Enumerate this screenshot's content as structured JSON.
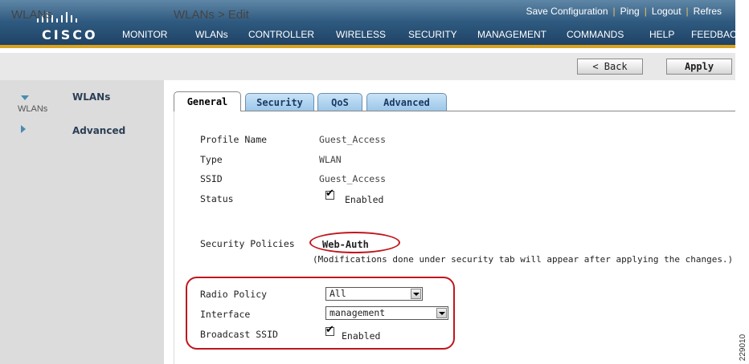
{
  "brand": {
    "logo_text": "CISCO"
  },
  "utility_links": {
    "save_configuration": "Save Configuration",
    "ping": "Ping",
    "logout": "Logout",
    "refresh": "Refres"
  },
  "main_nav": {
    "monitor": "MONITOR",
    "wlans": "WLANs",
    "controller": "CONTROLLER",
    "wireless": "WIRELESS",
    "security": "SECURITY",
    "management": "MANAGEMENT",
    "commands": "COMMANDS",
    "help": "HELP",
    "feedback": "FEEDBAC"
  },
  "sidebar": {
    "title": "WLANs",
    "items": [
      {
        "label": "WLANs",
        "sublabel": "WLANs",
        "expanded": true
      },
      {
        "label": "Advanced",
        "expanded": false
      }
    ]
  },
  "header": {
    "title": "WLANs > Edit",
    "back_label": "< Back",
    "apply_label": "Apply"
  },
  "tabs": [
    {
      "label": "General",
      "active": true
    },
    {
      "label": "Security",
      "active": false
    },
    {
      "label": "QoS",
      "active": false
    },
    {
      "label": "Advanced",
      "active": false
    }
  ],
  "general": {
    "profile_name": {
      "label": "Profile Name",
      "value": "Guest_Access"
    },
    "type": {
      "label": "Type",
      "value": "WLAN"
    },
    "ssid": {
      "label": "SSID",
      "value": "Guest_Access"
    },
    "status": {
      "label": "Status",
      "checkbox_label": "Enabled",
      "checked": true
    },
    "security_policies": {
      "label": "Security Policies",
      "value": "Web-Auth",
      "note": "(Modifications done under security tab will appear after applying the changes.)"
    },
    "radio_policy": {
      "label": "Radio Policy",
      "selected": "All"
    },
    "interface": {
      "label": "Interface",
      "selected": "management"
    },
    "broadcast_ssid": {
      "label": "Broadcast SSID",
      "checkbox_label": "Enabled",
      "checked": true
    }
  },
  "watermark": "229010",
  "colors": {
    "header_top": "#5f86a6",
    "header_bottom": "#1d3f62",
    "accent_orange": "#d9a21e",
    "annotation_red": "#c0161c",
    "tab_blue": "#9cc7ea"
  }
}
